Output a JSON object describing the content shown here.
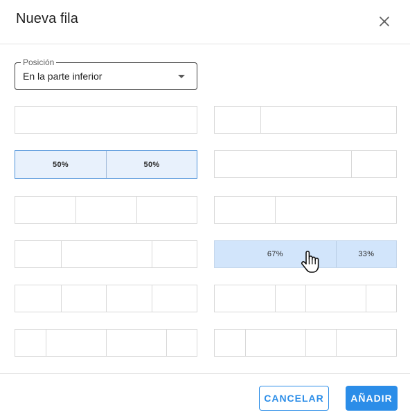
{
  "dialog": {
    "title": "Nueva fila",
    "close_icon": "close-icon"
  },
  "position_select": {
    "label": "Posición",
    "value": "En la parte inferior"
  },
  "layouts": [
    {
      "id": "1",
      "cells": [
        {
          "width_pct": 100,
          "label": ""
        }
      ]
    },
    {
      "id": "1-4_3-4",
      "cells": [
        {
          "width_pct": 25,
          "label": ""
        },
        {
          "width_pct": 75,
          "label": ""
        }
      ]
    },
    {
      "id": "1-2_1-2",
      "selected": true,
      "cells": [
        {
          "width_pct": 50,
          "label": "50%"
        },
        {
          "width_pct": 50,
          "label": "50%"
        }
      ]
    },
    {
      "id": "3-4_1-4",
      "cells": [
        {
          "width_pct": 75,
          "label": ""
        },
        {
          "width_pct": 25,
          "label": ""
        }
      ]
    },
    {
      "id": "1-3x3",
      "cells": [
        {
          "width_pct": 33.33,
          "label": ""
        },
        {
          "width_pct": 33.33,
          "label": ""
        },
        {
          "width_pct": 33.34,
          "label": ""
        }
      ]
    },
    {
      "id": "1-3_2-3",
      "cells": [
        {
          "width_pct": 33.33,
          "label": ""
        },
        {
          "width_pct": 66.67,
          "label": ""
        }
      ]
    },
    {
      "id": "1-4_1-2_1-4",
      "cells": [
        {
          "width_pct": 25,
          "label": ""
        },
        {
          "width_pct": 50,
          "label": ""
        },
        {
          "width_pct": 25,
          "label": ""
        }
      ]
    },
    {
      "id": "2-3_1-3",
      "hovered": true,
      "cells": [
        {
          "width_pct": 66.67,
          "label": "67%"
        },
        {
          "width_pct": 33.33,
          "label": "33%"
        }
      ]
    },
    {
      "id": "1-4x4",
      "cells": [
        {
          "width_pct": 25,
          "label": ""
        },
        {
          "width_pct": 25,
          "label": ""
        },
        {
          "width_pct": 25,
          "label": ""
        },
        {
          "width_pct": 25,
          "label": ""
        }
      ]
    },
    {
      "id": "1-3_1-6_1-3_1-6",
      "cells": [
        {
          "width_pct": 33.33,
          "label": ""
        },
        {
          "width_pct": 16.67,
          "label": ""
        },
        {
          "width_pct": 33.33,
          "label": ""
        },
        {
          "width_pct": 16.67,
          "label": ""
        }
      ]
    },
    {
      "id": "1-6_1-3_1-3_1-6",
      "cells": [
        {
          "width_pct": 16.67,
          "label": ""
        },
        {
          "width_pct": 33.33,
          "label": ""
        },
        {
          "width_pct": 33.33,
          "label": ""
        },
        {
          "width_pct": 16.67,
          "label": ""
        }
      ]
    },
    {
      "id": "1-6_1-3_1-6_1-3",
      "cells": [
        {
          "width_pct": 16.67,
          "label": ""
        },
        {
          "width_pct": 33.33,
          "label": ""
        },
        {
          "width_pct": 16.67,
          "label": ""
        },
        {
          "width_pct": 33.33,
          "label": ""
        }
      ]
    }
  ],
  "footer": {
    "cancel_label": "CANCELAR",
    "add_label": "AÑADIR"
  },
  "colors": {
    "accent": "#2b8de8",
    "selected_bg": "#e8f1fc",
    "hover_bg": "#d2e5fb"
  },
  "cursor_icon": "hand-pointer-icon"
}
